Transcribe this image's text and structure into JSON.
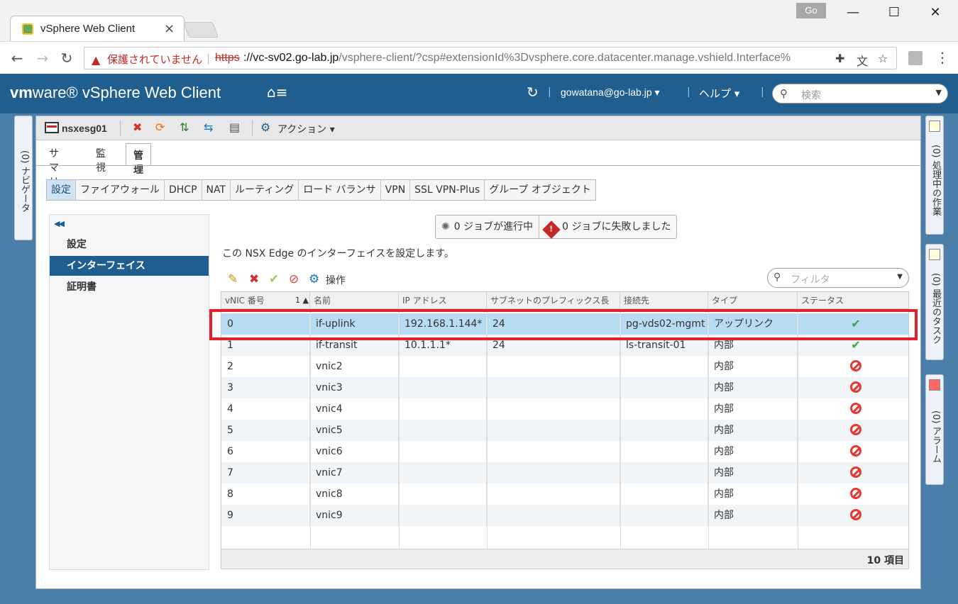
{
  "browser": {
    "tab_title": "vSphere Web Client",
    "profile_badge": "Go",
    "security_warning": "保護されていません",
    "url_scheme": "https",
    "url_host": "://vc-sv02.go-lab.jp",
    "url_path": "/vsphere-client/?csp#extensionId%3Dvsphere.core.datacenter.manage.vshield.Interface%"
  },
  "header": {
    "logo_vm": "vm",
    "logo_ware": "ware",
    "logo_product": "vSphere Web Client",
    "user": "gowatana@go-lab.jp",
    "help": "ヘルプ",
    "search_placeholder": "検索"
  },
  "left_rail": {
    "label": "(0) ナビゲータ"
  },
  "right_rail": {
    "tasks": "(0) 処理中の作業",
    "recent": "(0) 最近のタスク",
    "alarms": "(0) アラーム"
  },
  "object": {
    "name": "nsxesg01",
    "actions_label": "アクション"
  },
  "tabs": [
    "サマリ",
    "監視",
    "管理"
  ],
  "subtabs": [
    "設定",
    "ファイアウォール",
    "DHCP",
    "NAT",
    "ルーティング",
    "ロード バランサ",
    "VPN",
    "SSL VPN-Plus",
    "グループ オブジェクト"
  ],
  "left_menu": [
    "設定",
    "インターフェイス",
    "証明書"
  ],
  "jobs": {
    "running": "0 ジョブが進行中",
    "failed": "0 ジョブに失敗しました"
  },
  "description": "この NSX Edge のインターフェイスを設定します。",
  "grid_toolbar": {
    "actions_label": "操作",
    "filter_placeholder": "フィルタ"
  },
  "grid": {
    "columns": [
      "vNIC 番号",
      "名前",
      "IP アドレス",
      "サブネットのプレフィックス長",
      "接続先",
      "タイプ",
      "ステータス"
    ],
    "sort_indicator": "1 ▲",
    "rows": [
      {
        "vnic": "0",
        "name": "if-uplink",
        "ip": "192.168.1.144*",
        "prefix": "24",
        "connected": "pg-vds02-mgmt",
        "type": "アップリンク",
        "status": "ok"
      },
      {
        "vnic": "1",
        "name": "if-transit",
        "ip": "10.1.1.1*",
        "prefix": "24",
        "connected": "ls-transit-01",
        "type": "内部",
        "status": "ok"
      },
      {
        "vnic": "2",
        "name": "vnic2",
        "ip": "",
        "prefix": "",
        "connected": "",
        "type": "内部",
        "status": "disabled"
      },
      {
        "vnic": "3",
        "name": "vnic3",
        "ip": "",
        "prefix": "",
        "connected": "",
        "type": "内部",
        "status": "disabled"
      },
      {
        "vnic": "4",
        "name": "vnic4",
        "ip": "",
        "prefix": "",
        "connected": "",
        "type": "内部",
        "status": "disabled"
      },
      {
        "vnic": "5",
        "name": "vnic5",
        "ip": "",
        "prefix": "",
        "connected": "",
        "type": "内部",
        "status": "disabled"
      },
      {
        "vnic": "6",
        "name": "vnic6",
        "ip": "",
        "prefix": "",
        "connected": "",
        "type": "内部",
        "status": "disabled"
      },
      {
        "vnic": "7",
        "name": "vnic7",
        "ip": "",
        "prefix": "",
        "connected": "",
        "type": "内部",
        "status": "disabled"
      },
      {
        "vnic": "8",
        "name": "vnic8",
        "ip": "",
        "prefix": "",
        "connected": "",
        "type": "内部",
        "status": "disabled"
      },
      {
        "vnic": "9",
        "name": "vnic9",
        "ip": "",
        "prefix": "",
        "connected": "",
        "type": "内部",
        "status": "disabled"
      }
    ],
    "footer": "10 項目"
  },
  "colors": {
    "header_bg": "#1f5e8f",
    "highlight": "#e0202a",
    "selected_row": "#b9dcf5"
  }
}
